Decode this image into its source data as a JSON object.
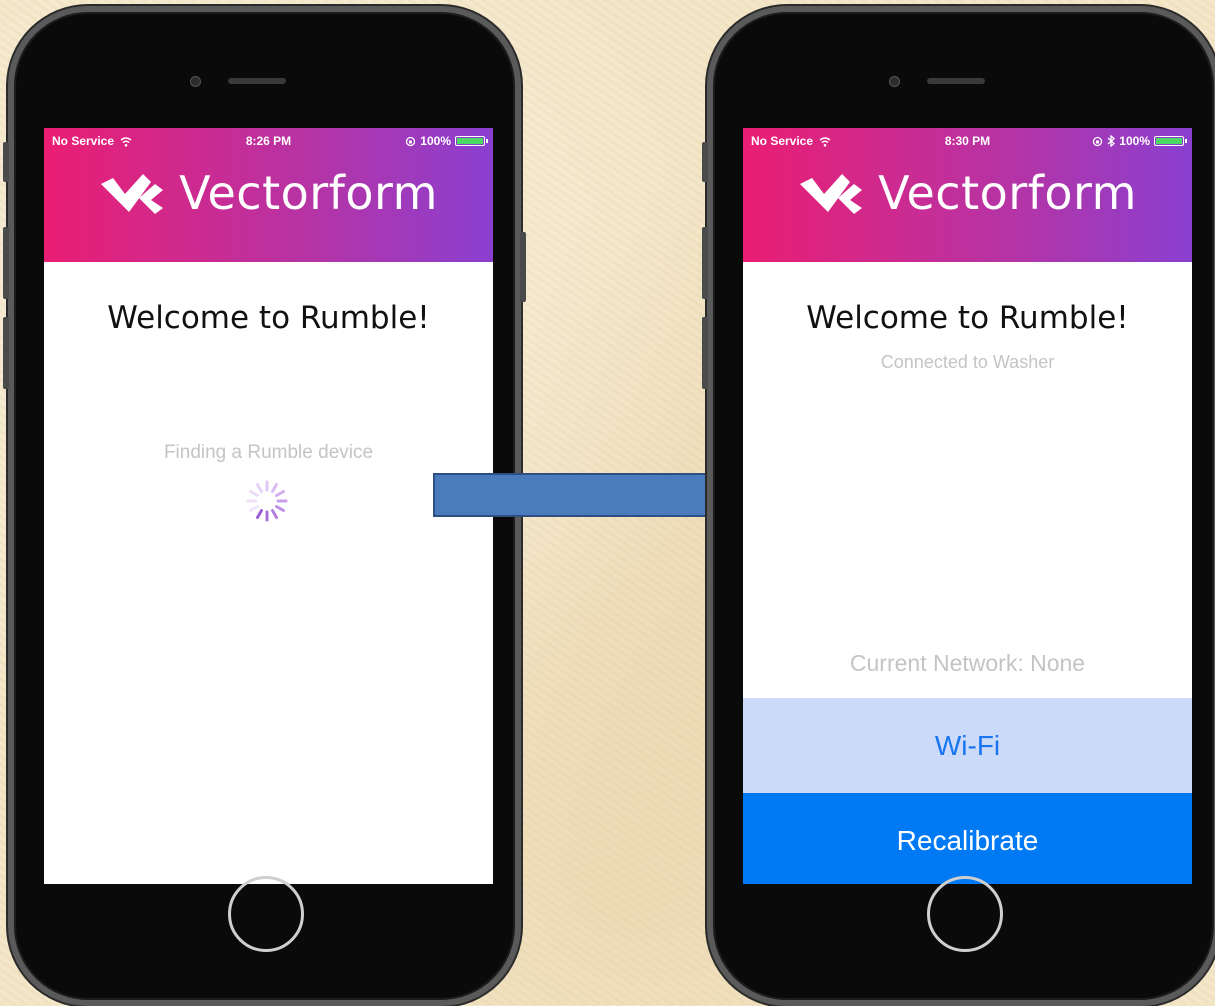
{
  "colors": {
    "header_gradient_start": "#ea1e73",
    "header_gradient_end": "#8a3fd0",
    "arrow_fill": "#4a7bbd",
    "wifi_button_bg": "#ccdaf9",
    "recalibrate_button_bg": "#0079f5"
  },
  "phone_left": {
    "status": {
      "carrier": "No Service",
      "time": "8:26 PM",
      "battery": "100%"
    },
    "brand": "Vectorform",
    "welcome": "Welcome to Rumble!",
    "finding_text": "Finding a Rumble device",
    "icons": [
      "wifi-icon",
      "lock-rotation-icon",
      "battery-icon",
      "vectorform-logo-icon",
      "loading-spinner-icon"
    ]
  },
  "phone_right": {
    "status": {
      "carrier": "No Service",
      "time": "8:30 PM",
      "battery": "100%"
    },
    "brand": "Vectorform",
    "welcome": "Welcome to Rumble!",
    "connected_text": "Connected to Washer",
    "network_text": "Current Network: None",
    "wifi_button": "Wi-Fi",
    "recalibrate_button": "Recalibrate",
    "icons": [
      "wifi-icon",
      "lock-rotation-icon",
      "bluetooth-icon",
      "battery-icon",
      "vectorform-logo-icon"
    ]
  },
  "arrow": {
    "direction": "right",
    "icon": "right-arrow-icon"
  }
}
